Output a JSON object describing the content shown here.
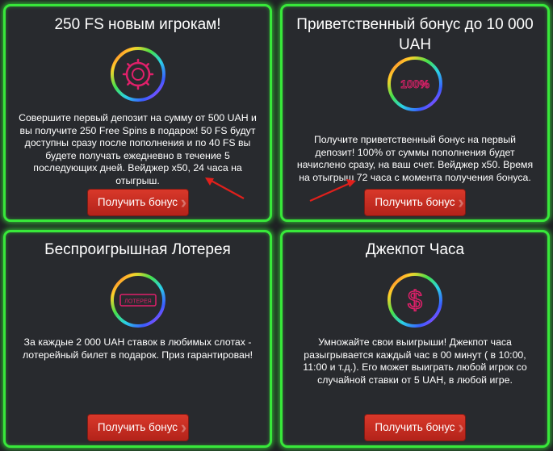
{
  "cards": [
    {
      "title": "250 FS новым игрокам!",
      "icon": "chip-icon",
      "text": "Совершите первый депозит на сумму от 500 UAH и вы получите 250 Free Spins в подарок! 50 FS будут доступны сразу после пополнения и по 40 FS вы будете получать ежедневно в течение 5 последующих дней. Вейджер х50, 24 часа на отыгрыш.",
      "button": "Получить бонус"
    },
    {
      "title": "Приветственный бонус до 10 000 UAH",
      "icon": "percent-icon",
      "icon_text": "100%",
      "text": "Получите приветственный бонус на первый депозит! 100% от суммы пополнения будет начислено сразу, на ваш счет. Вейджер х50. Время на отыгрыш 72 часа с момента получения бонуса.",
      "button": "Получить бонус"
    },
    {
      "title": "Беспроигрышная Лотерея",
      "icon": "lottery-ticket-icon",
      "icon_text": "ЛОТЕРЕЯ",
      "text": "За каждые 2 000 UAH ставок в любимых слотах - лотерейный билет в подарок. Приз гарантирован!",
      "button": "Получить бонус"
    },
    {
      "title": "Джекпот Часа",
      "icon": "dollar-icon",
      "icon_text": "$",
      "text": "Умножайте свои выигрыши! Джекпот часа разыгрывается каждый час в 00 минут ( в 10:00, 11:00 и т.д.). Его может выиграть любой игрок со случайной ставки от 5 UAH, в любой игре.",
      "button": "Получить бонус"
    }
  ],
  "colors": {
    "card_border": "#38e83a",
    "button": "#c62d21",
    "arrow": "#e0201c",
    "icon_pink": "#e0206a"
  }
}
